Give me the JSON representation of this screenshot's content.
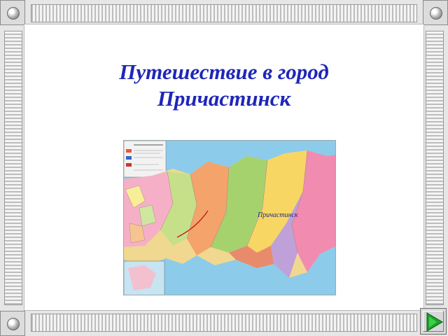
{
  "slide": {
    "title_line1": "Путешествие в город",
    "title_line2": "Причастинск"
  },
  "map": {
    "city_label": "Причастинск"
  },
  "navigation": {
    "next_icon": "next-arrow-icon"
  },
  "colors": {
    "title": "#1f26b8",
    "next_arrow": "#1aa12a"
  }
}
